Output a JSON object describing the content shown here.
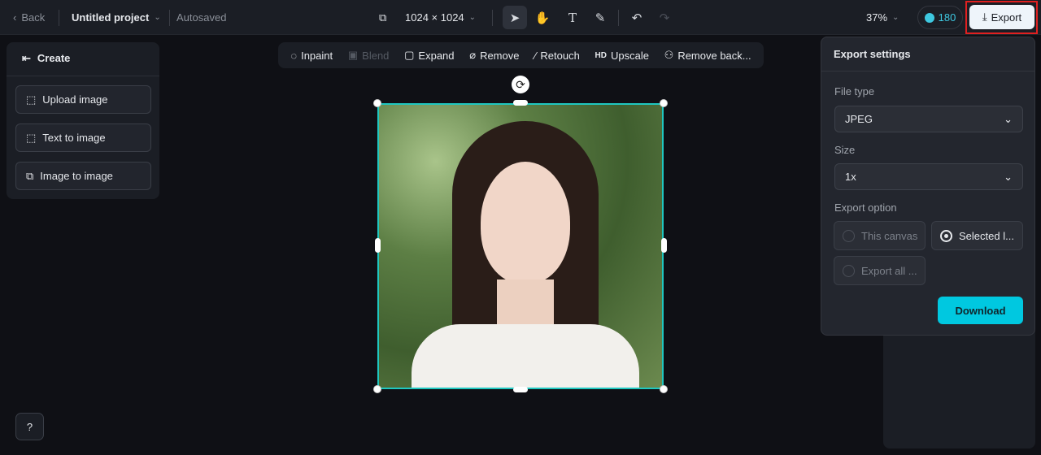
{
  "topbar": {
    "back": "Back",
    "project": "Untitled project",
    "status": "Autosaved",
    "canvas_size": "1024 × 1024",
    "zoom": "37%",
    "credits": "180",
    "export": "Export"
  },
  "sidebar": {
    "title": "Create",
    "items": [
      {
        "label": "Upload image"
      },
      {
        "label": "Text to image"
      },
      {
        "label": "Image to image"
      }
    ]
  },
  "edit_toolbar": {
    "items": [
      {
        "label": "Inpaint"
      },
      {
        "label": "Blend"
      },
      {
        "label": "Expand"
      },
      {
        "label": "Remove"
      },
      {
        "label": "Retouch"
      },
      {
        "label": "Upscale",
        "prefix": "HD"
      },
      {
        "label": "Remove back..."
      }
    ]
  },
  "export_panel": {
    "title": "Export settings",
    "file_type_label": "File type",
    "file_type": "JPEG",
    "size_label": "Size",
    "size": "1x",
    "option_label": "Export option",
    "options": [
      {
        "label": "This canvas",
        "selected": false
      },
      {
        "label": "Selected l...",
        "selected": true
      },
      {
        "label": "Export all ...",
        "selected": false
      }
    ],
    "download": "Download"
  },
  "colors": {
    "accent": "#00c8e0",
    "selection": "#1fc7c0",
    "highlight": "#e02020"
  }
}
